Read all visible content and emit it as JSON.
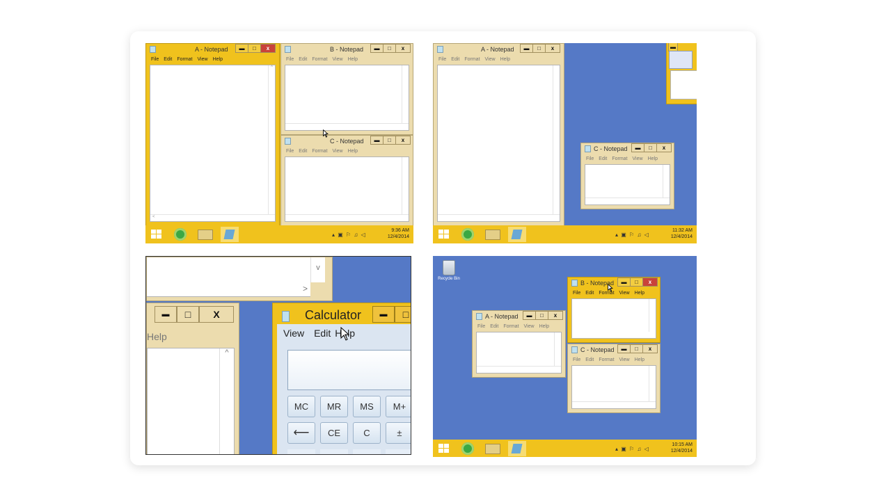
{
  "panel_tl": {
    "window_a": {
      "title": "A - Notepad",
      "menu": [
        "File",
        "Edit",
        "Format",
        "View",
        "Help"
      ]
    },
    "window_b": {
      "title": "B - Notepad",
      "menu": [
        "File",
        "Edit",
        "Format",
        "View",
        "Help"
      ]
    },
    "window_c": {
      "title": "C - Notepad",
      "menu": [
        "File",
        "Edit",
        "Format",
        "View",
        "Help"
      ]
    },
    "clock": {
      "time": "9:36 AM",
      "date": "12/4/2014"
    }
  },
  "panel_tr": {
    "window_a": {
      "title": "A - Notepad",
      "menu": [
        "File",
        "Edit",
        "Format",
        "View",
        "Help"
      ]
    },
    "window_c": {
      "title": "C - Notepad",
      "menu": [
        "File",
        "Edit",
        "Format",
        "View",
        "Help"
      ]
    },
    "clock": {
      "time": "11:32 AM",
      "date": "12/4/2014"
    }
  },
  "panel_bl": {
    "notepad_menu_fragment": "Help",
    "calculator": {
      "title": "Calculator",
      "menu": [
        "View",
        "Edit",
        "Help"
      ]
    },
    "buttons": [
      "MC",
      "MR",
      "MS",
      "M+",
      "⟵",
      "CE",
      "C",
      "±"
    ],
    "ctl_minimize": "▬",
    "ctl_maximize": "□",
    "ctl_close": "X"
  },
  "panel_br": {
    "recycle_bin_label": "Recycle Bin",
    "window_a": {
      "title": "A - Notepad",
      "menu": [
        "File",
        "Edit",
        "Format",
        "View",
        "Help"
      ]
    },
    "window_b": {
      "title": "B - Notepad",
      "menu": [
        "File",
        "Edit",
        "Format",
        "View",
        "Help"
      ]
    },
    "window_c": {
      "title": "C - Notepad",
      "menu": [
        "File",
        "Edit",
        "Format",
        "View",
        "Help"
      ]
    },
    "clock": {
      "time": "10:15 AM",
      "date": "12/4/2014"
    }
  },
  "controls": {
    "minimize": "▬",
    "maximize": "□",
    "close": "x"
  },
  "scroll": {
    "up": "^",
    "down": "v",
    "left": "<",
    "right": ">"
  },
  "tray_icons": "▴ ▣ ⚐ ♫ ◁",
  "colors": {
    "accent_yellow": "#f0c21d",
    "desktop_blue": "#5579c6",
    "inactive_frame": "#ecdcae",
    "close_red": "#c9433a"
  }
}
